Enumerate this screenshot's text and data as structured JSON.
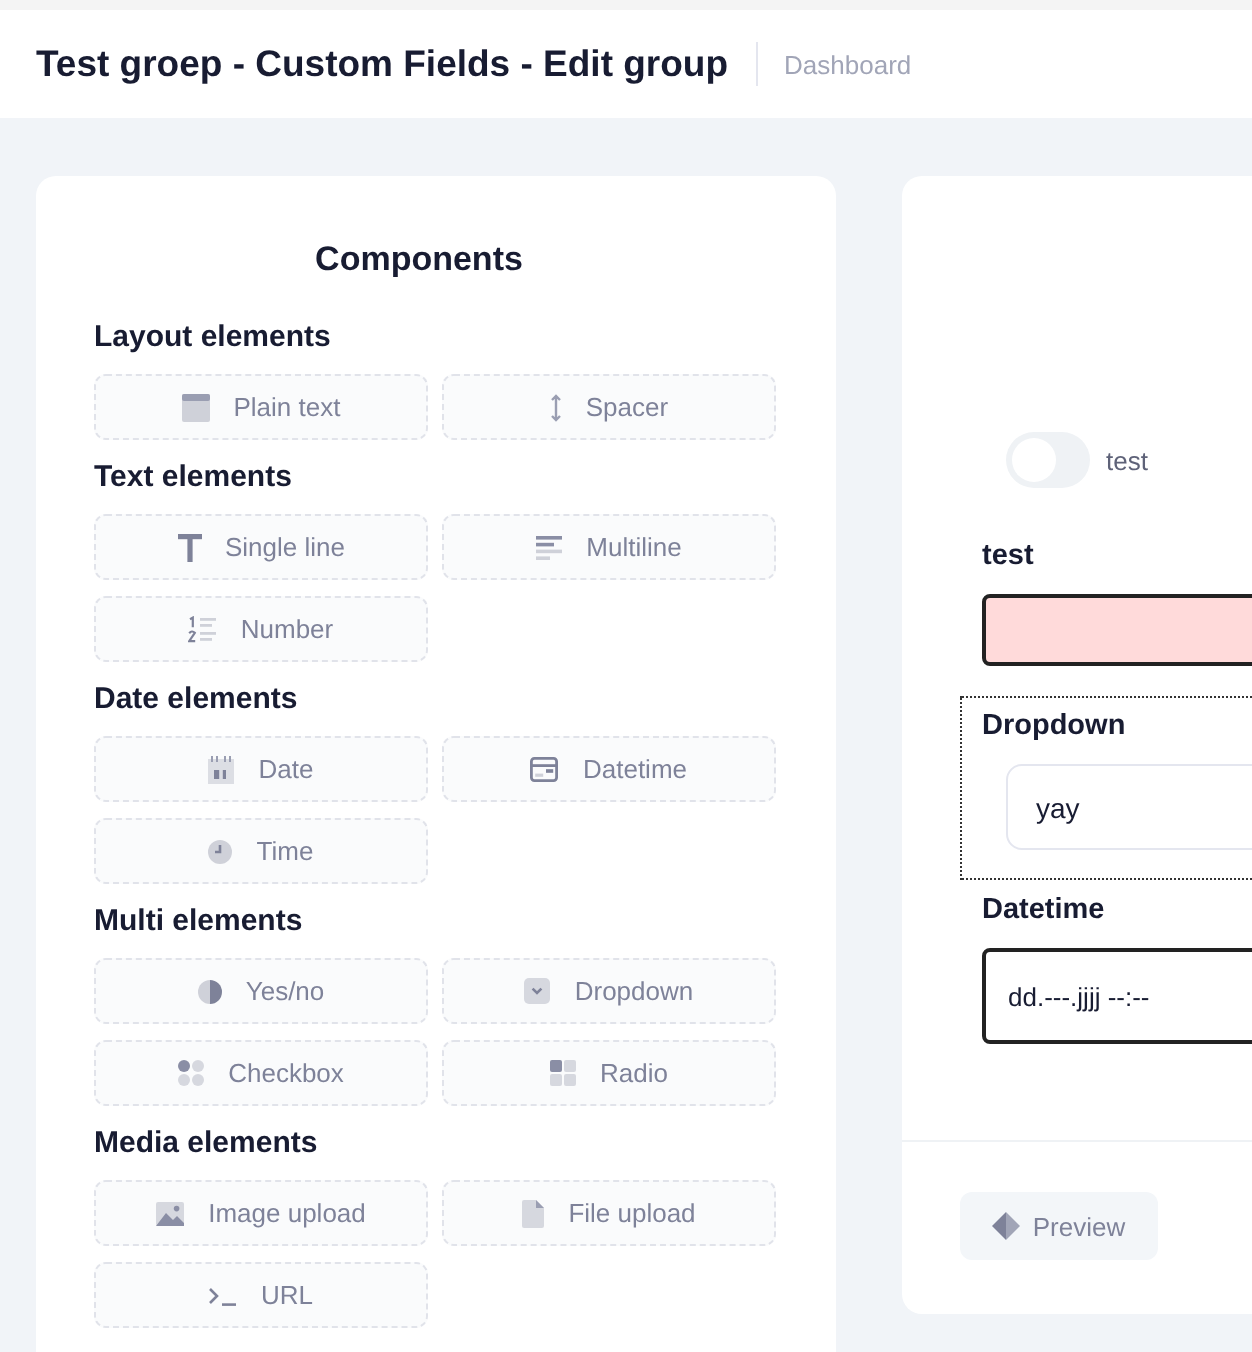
{
  "header": {
    "title": "Test groep - Custom Fields - Edit group",
    "breadcrumb": "Dashboard"
  },
  "components_panel": {
    "title": "Components",
    "sections": [
      {
        "heading": "Layout elements",
        "items": [
          {
            "label": "Plain text",
            "kind": "plaintext"
          },
          {
            "label": "Spacer",
            "kind": "spacer"
          }
        ]
      },
      {
        "heading": "Text elements",
        "items": [
          {
            "label": "Single line",
            "kind": "singleline"
          },
          {
            "label": "Multiline",
            "kind": "multiline"
          },
          {
            "label": "Number",
            "kind": "number"
          }
        ]
      },
      {
        "heading": "Date elements",
        "items": [
          {
            "label": "Date",
            "kind": "date"
          },
          {
            "label": "Datetime",
            "kind": "datetime"
          },
          {
            "label": "Time",
            "kind": "time"
          }
        ]
      },
      {
        "heading": "Multi elements",
        "items": [
          {
            "label": "Yes/no",
            "kind": "yesno"
          },
          {
            "label": "Dropdown",
            "kind": "dropdown"
          },
          {
            "label": "Checkbox",
            "kind": "checkbox"
          },
          {
            "label": "Radio",
            "kind": "radio"
          }
        ]
      },
      {
        "heading": "Media elements",
        "items": [
          {
            "label": "Image upload",
            "kind": "image"
          },
          {
            "label": "File upload",
            "kind": "file"
          },
          {
            "label": "URL",
            "kind": "url"
          }
        ]
      }
    ]
  },
  "form_preview": {
    "fields": [
      {
        "kind": "toggle",
        "label": "test",
        "on": false,
        "selected": false
      },
      {
        "kind": "text",
        "label": "test",
        "invalid": true,
        "selected": false
      },
      {
        "kind": "select",
        "label": "Dropdown",
        "value": "yay",
        "selected": true
      },
      {
        "kind": "datetime",
        "label": "Datetime",
        "placeholder": "dd.---.jjjj --:--",
        "selected": false
      }
    ],
    "preview_button": "Preview"
  }
}
